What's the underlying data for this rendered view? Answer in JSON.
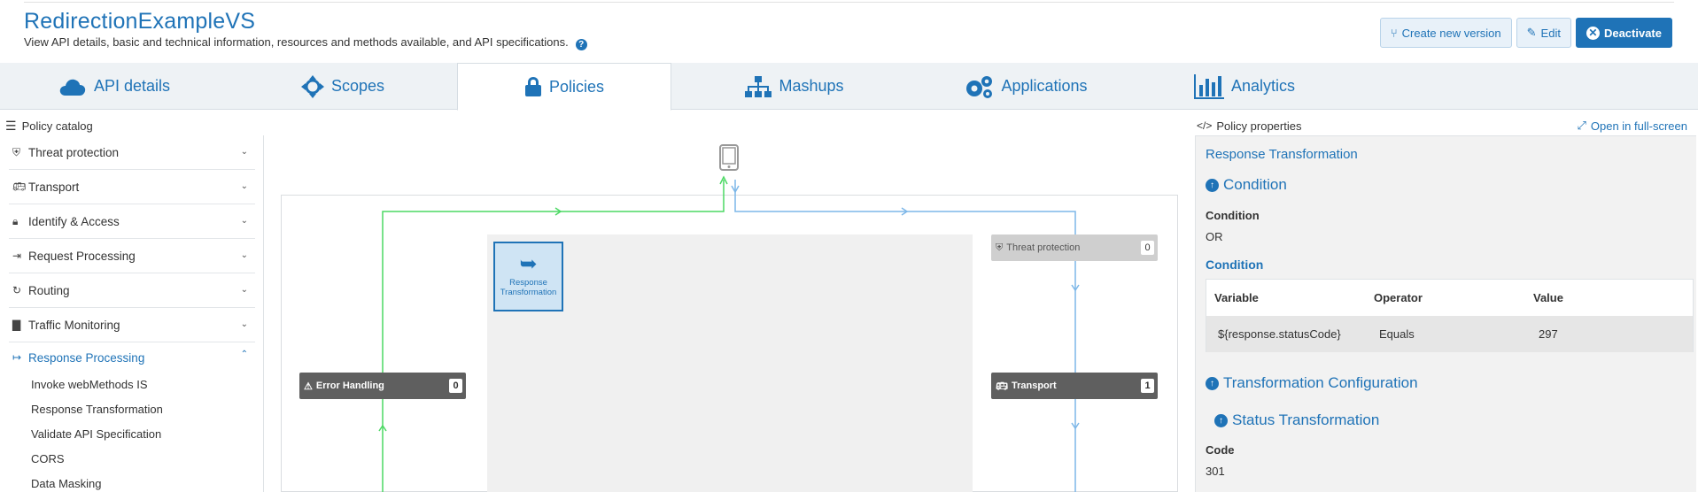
{
  "header": {
    "title": "RedirectionExampleVS",
    "description": "View API details, basic and technical information, resources and methods available, and API specifications.",
    "help_icon": "?",
    "actions": {
      "create_version": "Create new version",
      "edit": "Edit",
      "deactivate": "Deactivate"
    }
  },
  "tabs": [
    {
      "label": "API details",
      "icon": "cloud-icon"
    },
    {
      "label": "Scopes",
      "icon": "crosshair-icon"
    },
    {
      "label": "Policies",
      "icon": "lock-icon",
      "active": true
    },
    {
      "label": "Mashups",
      "icon": "sitemap-icon"
    },
    {
      "label": "Applications",
      "icon": "gears-icon"
    },
    {
      "label": "Analytics",
      "icon": "bar-chart-icon"
    }
  ],
  "catalog": {
    "title": "Policy catalog",
    "items": [
      {
        "label": "Threat protection",
        "icon": "shield-icon"
      },
      {
        "label": "Transport",
        "icon": "bus-icon"
      },
      {
        "label": "Identify & Access",
        "icon": "user-lock-icon"
      },
      {
        "label": "Request Processing",
        "icon": "sign-in-icon"
      },
      {
        "label": "Routing",
        "icon": "refresh-icon"
      },
      {
        "label": "Traffic Monitoring",
        "icon": "bar-chart-icon"
      },
      {
        "label": "Response Processing",
        "icon": "sign-out-icon",
        "open": true
      }
    ],
    "sub_items": [
      "Invoke webMethods IS",
      "Response Transformation",
      "Validate API Specification",
      "CORS",
      "Data Masking"
    ]
  },
  "canvas": {
    "selected_policy": "Response Transformation",
    "stages": {
      "threat_protection": {
        "label": "Threat protection",
        "count": "0"
      },
      "error_handling": {
        "label": "Error Handling",
        "count": "0"
      },
      "transport": {
        "label": "Transport",
        "count": "1"
      }
    },
    "colors": {
      "response_flow": "#4cd964",
      "request_flow": "#7db7e8"
    }
  },
  "properties": {
    "title": "Policy properties",
    "open_fullscreen": "Open in full-screen",
    "policy_name": "Response Transformation",
    "condition_section": "Condition",
    "condition_label": "Condition",
    "condition_value": "OR",
    "condition_sub": "Condition",
    "table": {
      "headers": [
        "Variable",
        "Operator",
        "Value"
      ],
      "row": [
        "${response.statusCode}",
        "Equals",
        "297"
      ]
    },
    "transformation_section": "Transformation Configuration",
    "status_section": "Status Transformation",
    "code_label": "Code",
    "code_value": "301"
  }
}
